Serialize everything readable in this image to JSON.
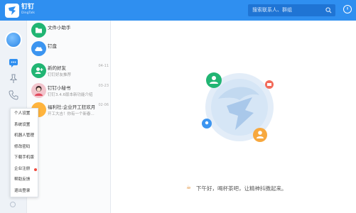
{
  "app": {
    "name": "钉钉",
    "name_en": "DingTalk"
  },
  "search": {
    "placeholder": "搜索联系人、群组"
  },
  "conversations": [
    {
      "title": "文件小助手",
      "subtitle": "",
      "time": ""
    },
    {
      "title": "钉盘",
      "subtitle": "",
      "time": ""
    },
    {
      "title": "新的好友",
      "subtitle": "钉钉好友推荐",
      "time": "04-11"
    },
    {
      "title": "钉钉小秘书",
      "subtitle": "钉钉3.4.6版本新功能介绍",
      "time": "03-23"
    },
    {
      "title": "福利社:企业开工狂欢月",
      "subtitle": "开工大吉！你有一个新春...",
      "time": "02-06"
    }
  ],
  "menu": {
    "items": [
      "个人设置",
      "系统设置",
      "机器人管理",
      "修改密码",
      "下载手机版",
      "企业注册",
      "帮助反馈",
      "退出登录"
    ],
    "badge_item_index": 5
  },
  "main": {
    "greeting": "下午好，喝杯茶吧，让精神抖擞起来。"
  },
  "colors": {
    "accent": "#2f8ff0",
    "badge": "#f04a3e"
  },
  "icons": [
    "dingtalk-logo-icon",
    "search-icon",
    "window-control-icon",
    "message-icon",
    "pin-icon",
    "phone-icon",
    "coffee-icon"
  ]
}
